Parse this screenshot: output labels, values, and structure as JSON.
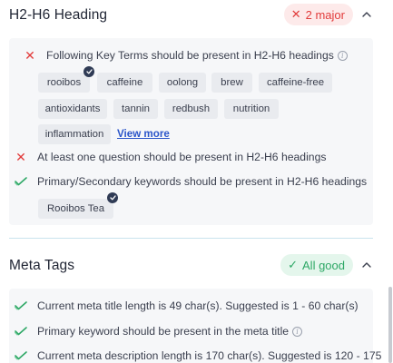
{
  "h_section": {
    "title": "H2-H6 Heading",
    "badge_icon": "✕",
    "badge_text": "2 major",
    "badge_color": "#e23c3c",
    "key_terms_text": "Following Key Terms should be present in H2-H6 headings",
    "key_terms": [
      {
        "label": "rooibos",
        "verified": true
      },
      {
        "label": "caffeine",
        "verified": false
      },
      {
        "label": "oolong",
        "verified": false
      },
      {
        "label": "brew",
        "verified": false
      },
      {
        "label": "caffeine-free",
        "verified": false
      },
      {
        "label": "antioxidants",
        "verified": false
      },
      {
        "label": "tannin",
        "verified": false
      },
      {
        "label": "redbush",
        "verified": false
      },
      {
        "label": "nutrition",
        "verified": false
      },
      {
        "label": "inflammation",
        "verified": false
      }
    ],
    "view_more": "View more",
    "question_text": "At least one question should be present in H2-H6 headings",
    "keywords_text": "Primary/Secondary keywords should be present in H2-H6 headings",
    "keyword_chip": "Rooibos Tea"
  },
  "meta_section": {
    "title": "Meta Tags",
    "badge_icon": "✓",
    "badge_text": "All good",
    "badge_color": "#2ea866",
    "checks": [
      "Current meta title length is 49 char(s). Suggested is 1 - 60 char(s)",
      "Primary keyword should be present in the meta title",
      "Current meta description length is 170 char(s). Suggested is 120 - 175"
    ]
  },
  "icons": {
    "fail": "x-icon",
    "pass": "check-icon",
    "info": "info-icon",
    "collapse": "chevron-up-icon",
    "verified": "verified-check-icon"
  }
}
